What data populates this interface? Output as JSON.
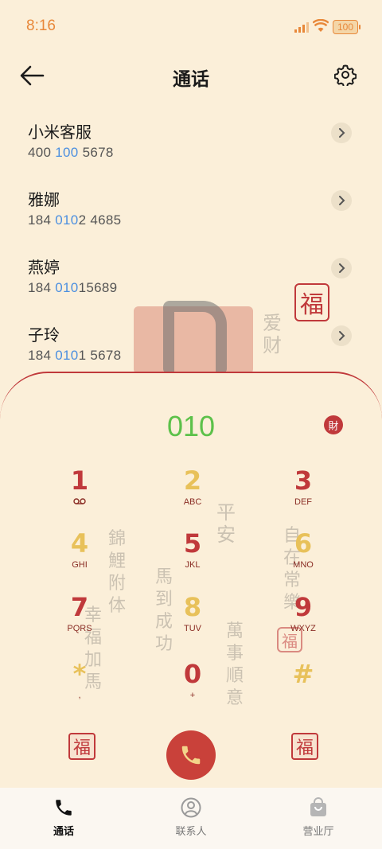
{
  "status": {
    "time": "8:16",
    "battery": "100"
  },
  "header": {
    "title": "通话",
    "back_icon": "arrow-left-icon",
    "settings_icon": "gear-icon"
  },
  "contacts": [
    {
      "name": "小米客服",
      "num_a": "400",
      "num_b": " 100",
      "num_c": " 5678"
    },
    {
      "name": "雅娜",
      "num_a": "184 ",
      "num_b": "010",
      "num_c": "2 4685"
    },
    {
      "name": "燕婷",
      "num_a": "184 ",
      "num_b": "010",
      "num_c": "15689"
    },
    {
      "name": "子玲",
      "num_a": "184 ",
      "num_b": "010",
      "num_c": "1 5678"
    }
  ],
  "dialer": {
    "value": "010",
    "badge": "財",
    "keys": [
      {
        "digit": "1",
        "letters": ""
      },
      {
        "digit": "2",
        "letters": "ABC"
      },
      {
        "digit": "3",
        "letters": "DEF"
      },
      {
        "digit": "4",
        "letters": "GHI"
      },
      {
        "digit": "5",
        "letters": "JKL"
      },
      {
        "digit": "6",
        "letters": "MNO"
      },
      {
        "digit": "7",
        "letters": "PQRS"
      },
      {
        "digit": "8",
        "letters": "TUV"
      },
      {
        "digit": "9",
        "letters": "WXYZ"
      },
      {
        "digit": "*",
        "letters": ","
      },
      {
        "digit": "0",
        "letters": "+"
      },
      {
        "digit": "#",
        "letters": ""
      }
    ],
    "left_seal": "福",
    "right_seal": "福"
  },
  "nav": [
    {
      "label": "通话",
      "icon": "phone-icon"
    },
    {
      "label": "联系人",
      "icon": "person-icon"
    },
    {
      "label": "营业厅",
      "icon": "shopping-bag-icon"
    }
  ],
  "decor_text": {
    "seal_top": "福",
    "v1": "爱财",
    "v2": "平安",
    "v3": "錦鯉附体",
    "v4": "馬到成功",
    "v5": "自在常樂",
    "v6": "幸福加馬",
    "v7": "萬事順意",
    "seal_fu": "福"
  },
  "colors": {
    "accent": "#c0393b",
    "gold": "#e8c15a",
    "dialed": "#5cc14a",
    "highlight": "#4b8fe0",
    "background": "#fbefd9"
  }
}
